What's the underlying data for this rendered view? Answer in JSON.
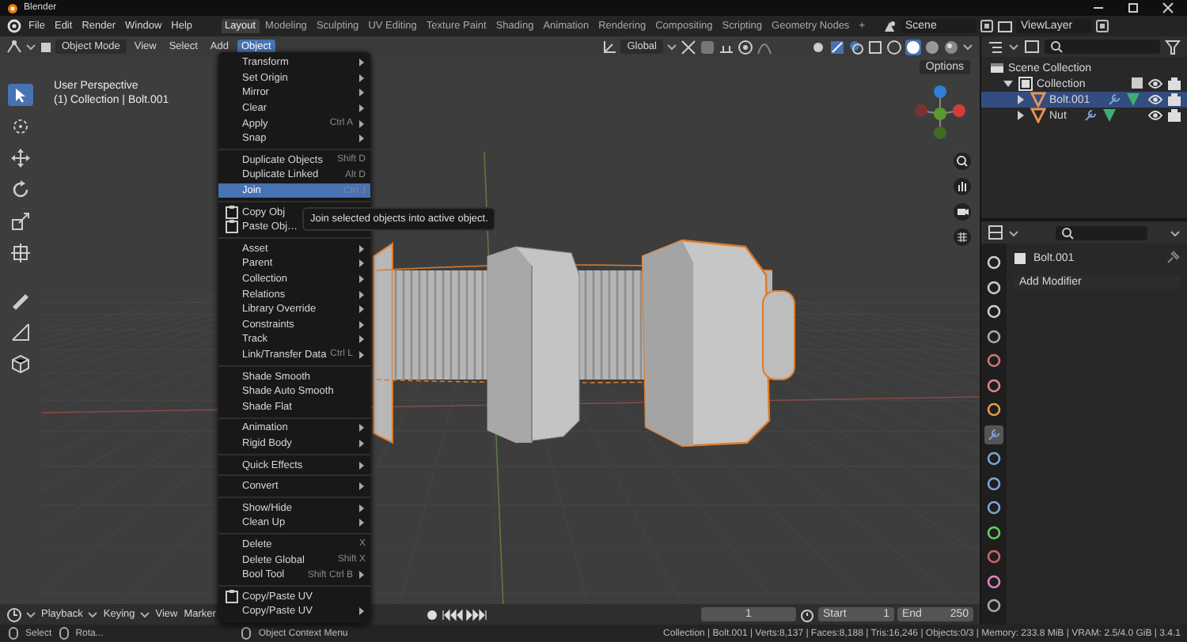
{
  "window": {
    "title": "Blender"
  },
  "top_menu": [
    "File",
    "Edit",
    "Render",
    "Window",
    "Help"
  ],
  "workspaces": [
    {
      "label": "Layout",
      "selected": true
    },
    {
      "label": "Modeling",
      "selected": false
    },
    {
      "label": "Sculpting",
      "selected": false
    },
    {
      "label": "UV Editing",
      "selected": false
    },
    {
      "label": "Texture Paint",
      "selected": false
    },
    {
      "label": "Shading",
      "selected": false
    },
    {
      "label": "Animation",
      "selected": false
    },
    {
      "label": "Rendering",
      "selected": false
    },
    {
      "label": "Compositing",
      "selected": false
    },
    {
      "label": "Scripting",
      "selected": false
    },
    {
      "label": "Geometry Nodes",
      "selected": false
    }
  ],
  "add_workspace": "+",
  "scene": "Scene",
  "view_layer": "ViewLayer",
  "viewport": {
    "mode": "Object Mode",
    "menus": [
      {
        "label": "View",
        "selected": false
      },
      {
        "label": "Select",
        "selected": false
      },
      {
        "label": "Add",
        "selected": false
      },
      {
        "label": "Object",
        "selected": true
      }
    ],
    "orientation": "Global",
    "options": "Options",
    "view_name": "User Perspective",
    "context": "(1) Collection | Bolt.001"
  },
  "object_menu": {
    "items": [
      {
        "kind": "item",
        "label": "Transform",
        "submenu": true,
        "selected": false
      },
      {
        "kind": "item",
        "label": "Set Origin",
        "submenu": true,
        "selected": false
      },
      {
        "kind": "item",
        "label": "Mirror",
        "submenu": true,
        "selected": false
      },
      {
        "kind": "item",
        "label": "Clear",
        "submenu": true,
        "selected": false
      },
      {
        "kind": "item",
        "label": "Apply",
        "shortcut": "Ctrl A",
        "submenu": true,
        "selected": false
      },
      {
        "kind": "item",
        "label": "Snap",
        "submenu": true,
        "selected": false
      },
      {
        "kind": "separator"
      },
      {
        "kind": "item",
        "label": "Duplicate Objects",
        "shortcut": "Shift D",
        "submenu": false,
        "selected": false
      },
      {
        "kind": "item",
        "label": "Duplicate Linked",
        "shortcut": "Alt D",
        "submenu": false,
        "selected": false
      },
      {
        "kind": "item",
        "label": "Join",
        "shortcut": "Ctrl J",
        "submenu": false,
        "selected": true
      },
      {
        "kind": "separator"
      },
      {
        "kind": "icon-item",
        "label": "Copy Obj",
        "selected": false
      },
      {
        "kind": "icon-item",
        "label": "Paste Obj…",
        "selected": false
      },
      {
        "kind": "separator"
      },
      {
        "kind": "item",
        "label": "Asset",
        "submenu": true,
        "selected": false
      },
      {
        "kind": "item",
        "label": "Parent",
        "submenu": true,
        "selected": false
      },
      {
        "kind": "item",
        "label": "Collection",
        "submenu": true,
        "selected": false
      },
      {
        "kind": "item",
        "label": "Relations",
        "submenu": true,
        "selected": false
      },
      {
        "kind": "item",
        "label": "Library Override",
        "submenu": true,
        "selected": false
      },
      {
        "kind": "item",
        "label": "Constraints",
        "submenu": true,
        "selected": false
      },
      {
        "kind": "item",
        "label": "Track",
        "submenu": true,
        "selected": false
      },
      {
        "kind": "item",
        "label": "Link/Transfer Data",
        "shortcut": "Ctrl L",
        "submenu": true,
        "selected": false
      },
      {
        "kind": "separator"
      },
      {
        "kind": "item",
        "label": "Shade Smooth",
        "submenu": false,
        "selected": false
      },
      {
        "kind": "item",
        "label": "Shade Auto Smooth",
        "submenu": false,
        "selected": false
      },
      {
        "kind": "item",
        "label": "Shade Flat",
        "submenu": false,
        "selected": false
      },
      {
        "kind": "separator"
      },
      {
        "kind": "item",
        "label": "Animation",
        "submenu": true,
        "selected": false
      },
      {
        "kind": "item",
        "label": "Rigid Body",
        "submenu": true,
        "selected": false
      },
      {
        "kind": "separator"
      },
      {
        "kind": "item",
        "label": "Quick Effects",
        "submenu": true,
        "selected": false
      },
      {
        "kind": "separator"
      },
      {
        "kind": "item",
        "label": "Convert",
        "submenu": true,
        "selected": false
      },
      {
        "kind": "separator"
      },
      {
        "kind": "item",
        "label": "Show/Hide",
        "submenu": true,
        "selected": false
      },
      {
        "kind": "item",
        "label": "Clean Up",
        "submenu": true,
        "selected": false
      },
      {
        "kind": "separator"
      },
      {
        "kind": "item",
        "label": "Delete",
        "shortcut": "X",
        "submenu": false,
        "selected": false
      },
      {
        "kind": "item",
        "label": "Delete Global",
        "shortcut": "Shift X",
        "submenu": false,
        "selected": false
      },
      {
        "kind": "item",
        "label": "Bool Tool",
        "shortcut": "Shift Ctrl B",
        "submenu": true,
        "selected": false
      },
      {
        "kind": "separator"
      },
      {
        "kind": "icon-item",
        "label": "Copy/Paste UV",
        "submenu": false,
        "selected": false
      },
      {
        "kind": "item",
        "label": "Copy/Paste UV",
        "submenu": true,
        "selected": false
      }
    ]
  },
  "tooltip": "Join selected objects into active object.",
  "outliner": {
    "items": [
      {
        "label": "Scene Collection",
        "selected": false,
        "children": [
          {
            "label": "Collection",
            "selected": false,
            "expanded": true,
            "children": [
              {
                "label": "Bolt.001",
                "selected": true,
                "expanded": false
              },
              {
                "label": "Nut",
                "selected": false,
                "expanded": false
              }
            ]
          }
        ]
      }
    ]
  },
  "properties": {
    "object_name": "Bolt.001",
    "add_modifier": "Add Modifier"
  },
  "timeline": {
    "menus": [
      "Playback",
      "Keying",
      "View",
      "Marker"
    ],
    "current_frame": "1",
    "start_label": "Start",
    "start": "1",
    "end_label": "End",
    "end": "250"
  },
  "status_bar": {
    "hints": [
      "Select",
      "Rota..."
    ],
    "context_hint": "Object Context Menu",
    "stats": "Collection | Bolt.001 | Verts:8,137 | Faces:8,188 | Tris:16,246 | Objects:0/3 | Memory: 233.8 MiB | VRAM: 2.5/4.0 GiB | 3.4.1"
  }
}
